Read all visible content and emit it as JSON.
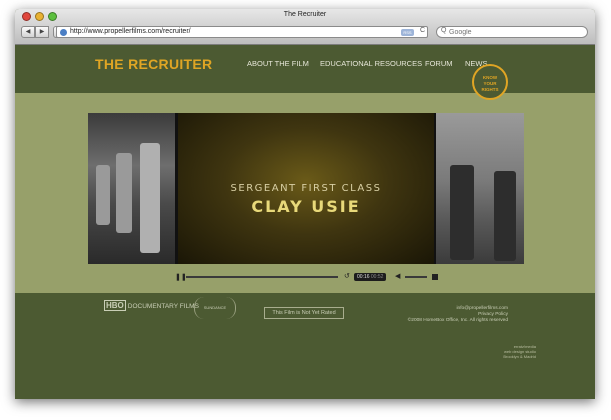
{
  "window": {
    "title": "The Recruiter"
  },
  "toolbar": {
    "back": "◀",
    "forward": "▶",
    "add": "+",
    "url": "http://www.propellerfilms.com/recruiter/",
    "rss_label": "RSS",
    "reload": "C",
    "search_icon": "Q",
    "search_placeholder": "Google"
  },
  "site": {
    "logo": "THE RECRUITER",
    "nav": [
      "ABOUT THE FILM",
      "EDUCATIONAL RESOURCES",
      "FORUM",
      "NEWS"
    ],
    "badge": [
      "KNOW",
      "YOUR",
      "RIGHTS"
    ]
  },
  "video": {
    "rank": "SERGEANT FIRST CLASS",
    "name": "CLAY USIE",
    "time_current": "00:16",
    "time_total": "00:52"
  },
  "footer": {
    "hbo_mark": "HBO",
    "hbo_text": "DOCUMENTARY FILMS",
    "sundance": "SUNDANCE",
    "rating": "This Film is Not Yet Rated",
    "email": "info@propellerfilms.com",
    "privacy": "Privacy Policy",
    "copyright": "©2008 HomeBox Office, Inc. All rights reserved",
    "credit": [
      "erratz!media",
      "web design studio",
      "Brooklyn & Madrid"
    ]
  }
}
